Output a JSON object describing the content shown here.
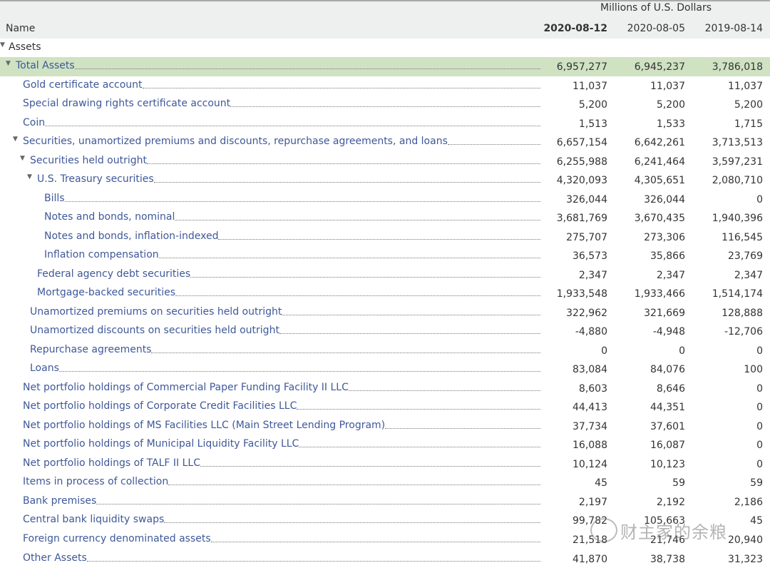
{
  "header": {
    "units": "Millions of U.S. Dollars",
    "name_label": "Name",
    "columns": [
      "2020-08-12",
      "2020-08-05",
      "2019-08-14"
    ]
  },
  "section": "Assets",
  "rows": [
    {
      "label": "Total Assets",
      "level": 0,
      "expand": true,
      "highlight": true,
      "values": [
        "6,957,277",
        "6,945,237",
        "3,786,018"
      ]
    },
    {
      "label": "Gold certificate account",
      "level": 1,
      "values": [
        "11,037",
        "11,037",
        "11,037"
      ]
    },
    {
      "label": "Special drawing rights certificate account",
      "level": 1,
      "values": [
        "5,200",
        "5,200",
        "5,200"
      ]
    },
    {
      "label": "Coin",
      "level": 1,
      "values": [
        "1,513",
        "1,533",
        "1,715"
      ]
    },
    {
      "label": "Securities, unamortized premiums and discounts, repurchase agreements, and loans",
      "level": 1,
      "expand": true,
      "values": [
        "6,657,154",
        "6,642,261",
        "3,713,513"
      ]
    },
    {
      "label": "Securities held outright",
      "level": 2,
      "expand": true,
      "values": [
        "6,255,988",
        "6,241,464",
        "3,597,231"
      ]
    },
    {
      "label": "U.S. Treasury securities",
      "level": 3,
      "expand": true,
      "values": [
        "4,320,093",
        "4,305,651",
        "2,080,710"
      ]
    },
    {
      "label": "Bills",
      "level": 4,
      "values": [
        "326,044",
        "326,044",
        "0"
      ]
    },
    {
      "label": "Notes and bonds, nominal",
      "level": 4,
      "values": [
        "3,681,769",
        "3,670,435",
        "1,940,396"
      ]
    },
    {
      "label": "Notes and bonds, inflation-indexed",
      "level": 4,
      "values": [
        "275,707",
        "273,306",
        "116,545"
      ]
    },
    {
      "label": "Inflation compensation",
      "level": 4,
      "values": [
        "36,573",
        "35,866",
        "23,769"
      ]
    },
    {
      "label": "Federal agency debt securities",
      "level": 3,
      "values": [
        "2,347",
        "2,347",
        "2,347"
      ]
    },
    {
      "label": "Mortgage-backed securities",
      "level": 3,
      "values": [
        "1,933,548",
        "1,933,466",
        "1,514,174"
      ]
    },
    {
      "label": "Unamortized premiums on securities held outright",
      "level": 2,
      "values": [
        "322,962",
        "321,669",
        "128,888"
      ]
    },
    {
      "label": "Unamortized discounts on securities held outright",
      "level": 2,
      "values": [
        "-4,880",
        "-4,948",
        "-12,706"
      ]
    },
    {
      "label": "Repurchase agreements",
      "level": 2,
      "values": [
        "0",
        "0",
        "0"
      ]
    },
    {
      "label": "Loans",
      "level": 2,
      "values": [
        "83,084",
        "84,076",
        "100"
      ]
    },
    {
      "label": "Net portfolio holdings of Commercial Paper Funding Facility II LLC",
      "level": 1,
      "values": [
        "8,603",
        "8,646",
        "0"
      ]
    },
    {
      "label": "Net portfolio holdings of Corporate Credit Facilities LLC",
      "level": 1,
      "values": [
        "44,413",
        "44,351",
        "0"
      ]
    },
    {
      "label": "Net portfolio holdings of MS Facilities LLC (Main Street Lending Program)",
      "level": 1,
      "values": [
        "37,734",
        "37,601",
        "0"
      ]
    },
    {
      "label": "Net portfolio holdings of Municipal Liquidity Facility LLC",
      "level": 1,
      "values": [
        "16,088",
        "16,087",
        "0"
      ]
    },
    {
      "label": "Net portfolio holdings of TALF II LLC",
      "level": 1,
      "values": [
        "10,124",
        "10,123",
        "0"
      ]
    },
    {
      "label": "Items in process of collection",
      "level": 1,
      "values": [
        "45",
        "59",
        "59"
      ]
    },
    {
      "label": "Bank premises",
      "level": 1,
      "values": [
        "2,197",
        "2,192",
        "2,186"
      ]
    },
    {
      "label": "Central bank liquidity swaps",
      "level": 1,
      "values": [
        "99,782",
        "105,663",
        "45"
      ]
    },
    {
      "label": "Foreign currency denominated assets",
      "level": 1,
      "values": [
        "21,518",
        "21,746",
        "20,940"
      ]
    },
    {
      "label": "Other Assets",
      "level": 1,
      "values": [
        "41,870",
        "38,738",
        "31,323"
      ]
    }
  ],
  "watermark": "财主家的余粮"
}
